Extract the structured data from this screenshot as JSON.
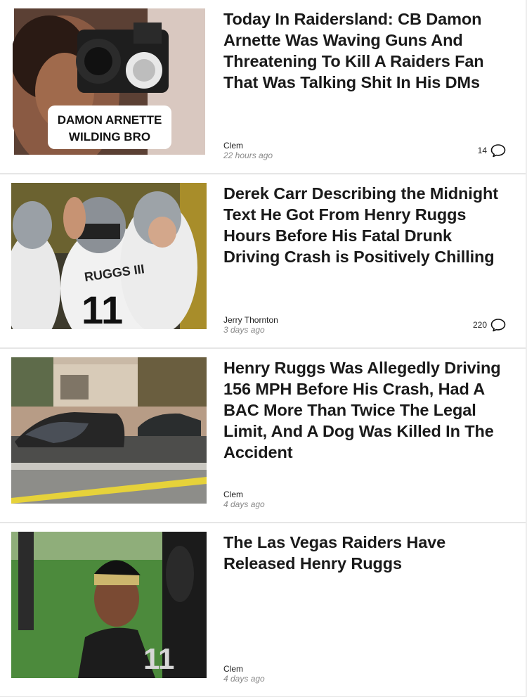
{
  "articles": [
    {
      "headline": "Today In Raidersland: CB Damon Arnette Was Waving Guns And Threatening To Kill A Raiders Fan That Was Talking Shit In His DMs",
      "author": "Clem",
      "time": "22 hours ago",
      "comments": "14",
      "thumb_caption_1": "DAMON ARNETTE",
      "thumb_caption_2": "WILDING BRO"
    },
    {
      "headline": "Derek Carr Describing the Midnight Text He Got From Henry Ruggs Hours Before His Fatal Drunk Driving Crash is Positively Chilling",
      "author": "Jerry Thornton",
      "time": "3 days ago",
      "comments": "220",
      "jersey_text": "RUGGS III",
      "jersey_number": "11"
    },
    {
      "headline": "Henry Ruggs Was Allegedly Driving 156 MPH Before His Crash, Had A BAC More Than Twice The Legal Limit, And A Dog Was Killed In The Accident",
      "author": "Clem",
      "time": "4 days ago"
    },
    {
      "headline": "The Las Vegas Raiders Have Released Henry Ruggs",
      "author": "Clem",
      "time": "4 days ago",
      "jersey_number": "11"
    }
  ]
}
